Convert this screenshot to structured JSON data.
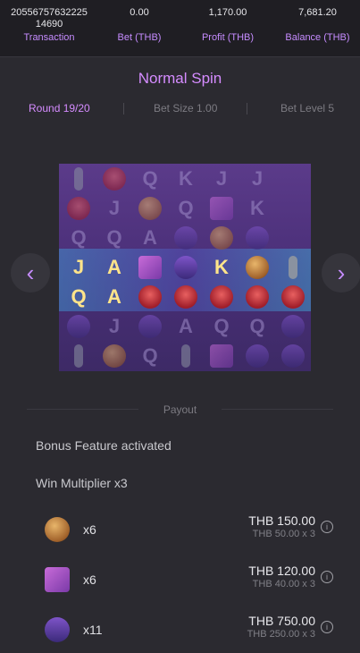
{
  "header": {
    "transaction_value": "20556757632225 14690",
    "transaction_label": "Transaction",
    "bet_value": "0.00",
    "bet_label": "Bet (THB)",
    "profit_value": "1,170.00",
    "profit_label": "Profit (THB)",
    "balance_value": "7,681.20",
    "balance_label": "Balance (THB)"
  },
  "spin": {
    "title": "Normal Spin",
    "round": "Round 19/20",
    "bet_size": "Bet Size 1.00",
    "bet_level": "Bet Level 5"
  },
  "reel": {
    "rows": [
      [
        "mic",
        "wild",
        "Q",
        "K",
        "J",
        "J"
      ],
      [
        "wild",
        "J",
        "coin",
        "Q",
        "disc",
        "K"
      ],
      [
        "Q",
        "Q",
        "A",
        "head",
        "coin",
        "head"
      ],
      [
        "J",
        "A",
        "disc",
        "head",
        "K",
        "coin",
        "mic"
      ],
      [
        "Q",
        "A",
        "wild",
        "wild",
        "wild",
        "wild",
        "wild"
      ],
      [
        "head",
        "J",
        "head",
        "A",
        "Q",
        "Q",
        "head"
      ],
      [
        "mic",
        "coin",
        "Q",
        "mic",
        "disc",
        "head",
        "head"
      ]
    ]
  },
  "payout": {
    "section_label": "Payout",
    "feature_1": "Bonus Feature activated",
    "feature_2": "Win Multiplier x3",
    "items": [
      {
        "symbol": "coin-icon",
        "count": "x6",
        "amount": "THB 150.00",
        "detail": "THB 50.00 x 3"
      },
      {
        "symbol": "disc-icon",
        "count": "x6",
        "amount": "THB 120.00",
        "detail": "THB 40.00 x 3"
      },
      {
        "symbol": "headphones-icon",
        "count": "x11",
        "amount": "THB 750.00",
        "detail": "THB 250.00 x 3"
      }
    ]
  },
  "nav": {
    "prev": "‹",
    "next": "›"
  }
}
